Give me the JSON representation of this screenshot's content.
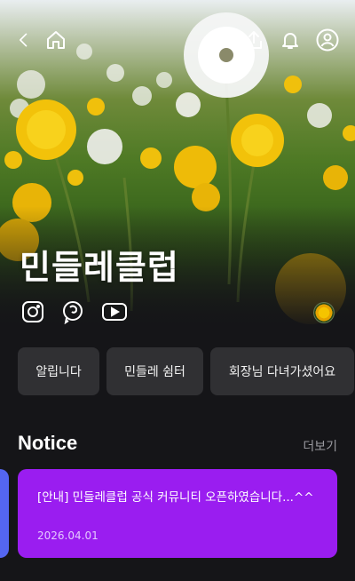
{
  "hero": {
    "title": "민들레클럽"
  },
  "topbar": {
    "icons": [
      "back-arrow-icon",
      "home-icon",
      "share-icon",
      "bell-icon",
      "profile-icon"
    ]
  },
  "socials": [
    "instagram-icon",
    "threads-icon",
    "youtube-icon"
  ],
  "chips": [
    {
      "label": "알립니다"
    },
    {
      "label": "민들레 쉼터"
    },
    {
      "label": "회장님 다녀가셨어요"
    }
  ],
  "notice": {
    "heading": "Notice",
    "more_label": "더보기",
    "card": {
      "title": "[안내] 민들레클럽 공식 커뮤니티 오픈하였습니다...^^",
      "date": "2026.04.01",
      "color": "#9a1df0"
    },
    "prev_card_color": "#5466f0"
  },
  "colors": {
    "background": "#151518",
    "chip": "#303033",
    "dandelion": "#f5c400"
  }
}
